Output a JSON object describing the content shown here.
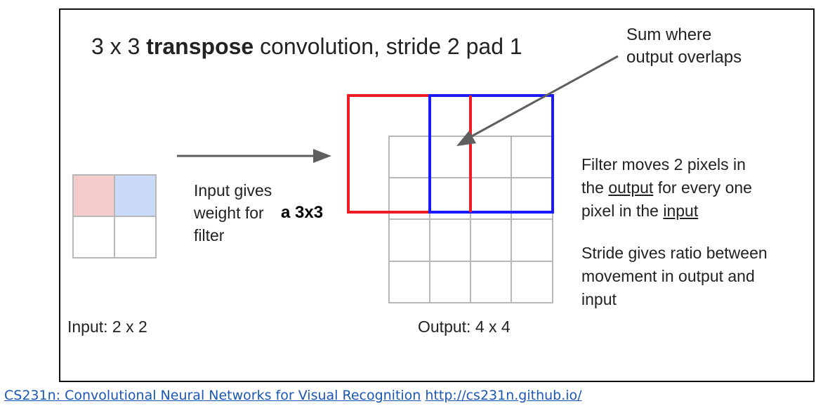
{
  "title": {
    "prefix": "3 x 3 ",
    "bold": "transpose",
    "suffix": " convolution, stride 2 pad 1"
  },
  "sum_note": [
    "Sum where",
    "output overlaps"
  ],
  "input_note": {
    "line1": "Input gives",
    "line2": "weight for",
    "line3": "filter",
    "bold": "a 3x3"
  },
  "filter_note": {
    "line1": "Filter moves 2 pixels in",
    "line2_pre": "the ",
    "line2_u": "output",
    "line2_post": " for every one",
    "line3_pre": "pixel in the ",
    "line3_u": "input"
  },
  "stride_note": [
    "Stride gives ratio between",
    "movement in output and",
    "input"
  ],
  "input_label": "Input: 2 x 2",
  "output_label": "Output: 4 x 4",
  "footer": {
    "text": "CS231n: Convolutional Neural Networks for Visual Recognition",
    "link": "http://cs231n.github.io/"
  },
  "colors": {
    "red": "#ee1c24",
    "blue": "#1a1aff",
    "pink": "#f4cccc",
    "lightblue": "#c9daf8",
    "grid": "#b8b8b8",
    "arrow": "#5f5f5f"
  }
}
